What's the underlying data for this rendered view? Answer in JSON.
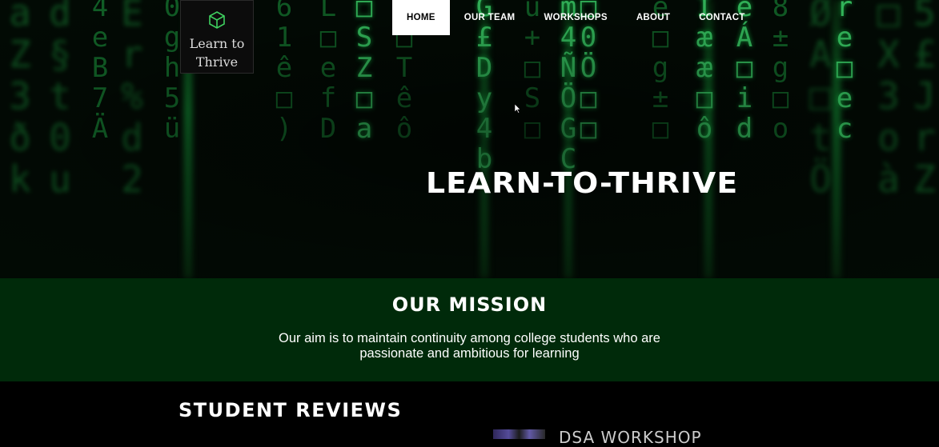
{
  "brand": {
    "logo_line1": "Learn to",
    "logo_line2": "Thrive",
    "icon": "cube-icon"
  },
  "nav": {
    "items": [
      {
        "label": "HOME",
        "active": true
      },
      {
        "label": "OUR TEAM",
        "active": false
      },
      {
        "label": "WORKSHOPS",
        "active": false
      },
      {
        "label": "ABOUT",
        "active": false
      },
      {
        "label": "CONTACT",
        "active": false
      }
    ]
  },
  "hero": {
    "title": "LEARN-TO-THRIVE"
  },
  "mission": {
    "title": "OUR MISSION",
    "line1": "Our aim is to maintain continuity among college students who are",
    "line2": "passionate and ambitious for learning"
  },
  "reviews": {
    "title": "STUDENT REVIEWS",
    "workshop_title": "DSA WORKSHOP"
  },
  "colors": {
    "mission_bg": "#002a0a",
    "matrix_green": "#1fa844",
    "page_bg": "#000000"
  }
}
